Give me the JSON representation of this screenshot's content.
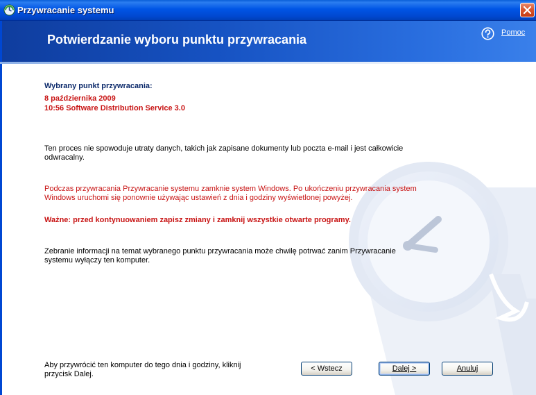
{
  "window": {
    "title": "Przywracanie systemu",
    "colors": {
      "titlebar": "#0055e5",
      "header": "#1652c2",
      "accent_red": "#c81414",
      "navy": "#0c2a6b"
    }
  },
  "header": {
    "title": "Potwierdzanie wyboru punktu przywracania",
    "help_label": "Pomoc",
    "help_icon": "question-mark-icon"
  },
  "restore_point": {
    "heading": "Wybrany punkt przywracania:",
    "date": "8 października 2009",
    "details": "10:56 Software Distribution Service 3.0"
  },
  "messages": {
    "no_data_loss_line1": "Ten proces nie spowoduje utraty danych, takich jak zapisane dokumenty lub poczta e-mail i jest całkowicie",
    "no_data_loss_line2": "odwracalny.",
    "windows_close_line1": "Podczas przywracania Przywracanie systemu zamknie system Windows. Po ukończeniu przywracania system",
    "windows_close_line2": "Windows uruchomi się ponownie używając ustawień z dnia i godziny wyświetlonej powyżej.",
    "warning": "Ważne: przed kontynuowaniem zapisz zmiany i zamknij wszystkie otwarte programy.",
    "shutdown_line1": "Zebranie informacji na temat wybranego punktu przywracania może chwilę potrwać zanim Przywracanie",
    "shutdown_line2": "systemu wyłączy ten komputer.",
    "instruction_line1": "Aby przywrócić ten komputer do tego dnia i godziny, kliknij",
    "instruction_line2": "przycisk Dalej."
  },
  "buttons": {
    "back": "< Wstecz",
    "next": "Dalej >",
    "cancel": "Anuluj"
  }
}
